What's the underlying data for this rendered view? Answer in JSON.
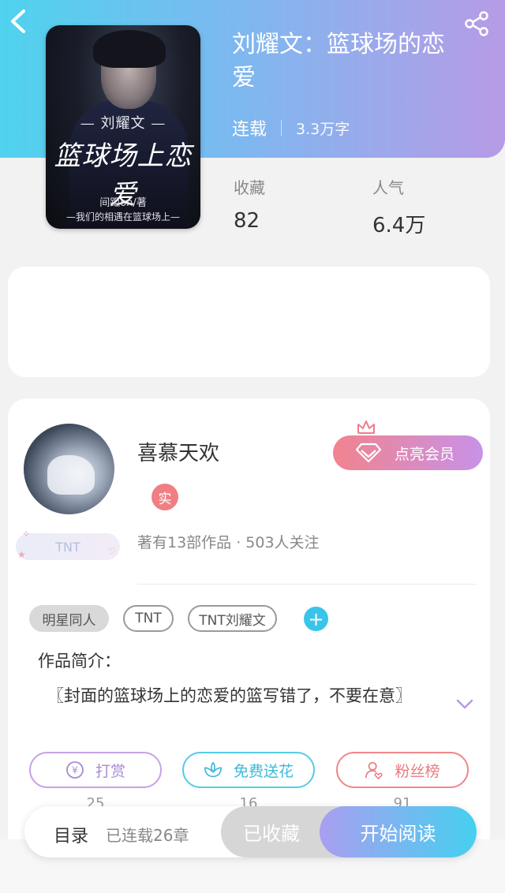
{
  "header": {
    "back_icon": "chevron-left-icon",
    "share_icon": "share-icon",
    "gradient": [
      "#4fd3ee",
      "#b79be6"
    ]
  },
  "book": {
    "title": "刘耀文：篮球场的恋爱",
    "status": "连载",
    "word_count": "3.3万字",
    "cover": {
      "line1": "— 刘耀文 —",
      "line2": "篮球场上恋爱",
      "line3": "间距on/著",
      "line4": "—我们的相遇在篮球场上—"
    },
    "stats": {
      "favorites_label": "收藏",
      "favorites_value": "82",
      "popularity_label": "人气",
      "popularity_value": "6.4万"
    }
  },
  "author": {
    "name": "喜慕天欢",
    "verified_badge": "实",
    "fan_badge": "TNT",
    "stats_text": "著有13部作品 · 503人关注",
    "vip_button": "点亮会员"
  },
  "tags": [
    "明星同人",
    "TNT",
    "TNT刘耀文"
  ],
  "intro": {
    "label": "作品简介：",
    "text": "〖封面的篮球场上的恋爱的篮写错了，不要在意〗"
  },
  "actions": [
    {
      "label": "打赏",
      "icon": "yen-coin-icon",
      "count": "25",
      "color": "#a78ad6"
    },
    {
      "label": "免费送花",
      "icon": "flower-icon",
      "count": "16",
      "color": "#3cb9db"
    },
    {
      "label": "粉丝榜",
      "icon": "user-heart-icon",
      "count": "91",
      "color": "#ea7a80"
    }
  ],
  "bottom_bar": {
    "toc_label": "目录",
    "toc_count": "已连载26章",
    "collected_label": "已收藏",
    "read_label": "开始阅读"
  }
}
